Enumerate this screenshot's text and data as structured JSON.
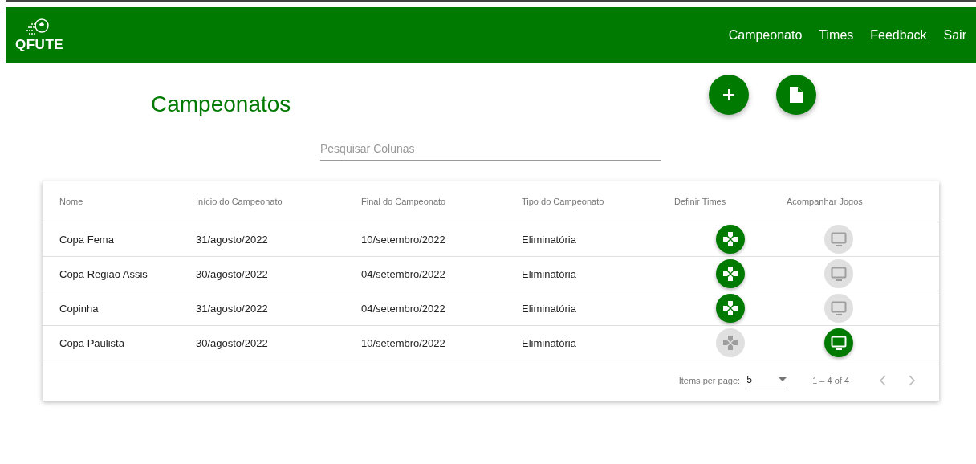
{
  "navbar": {
    "logo": "QFUTE",
    "links": [
      "Campeonato",
      "Times",
      "Feedback",
      "Sair"
    ]
  },
  "page": {
    "title": "Campeonatos"
  },
  "search": {
    "placeholder": "Pesquisar Colunas"
  },
  "table": {
    "columns": [
      "Nome",
      "Início do Campeonato",
      "Final do Campeonato",
      "Tipo do Campeonato",
      "Definir Times",
      "Acompanhar Jogos"
    ],
    "rows": [
      {
        "cells": [
          "Copa Fema",
          "31/agosto/2022",
          "10/setembro/2022",
          "Eliminatória"
        ],
        "define_disabled": false,
        "follow_disabled": true
      },
      {
        "cells": [
          "Copa Região Assis",
          "30/agosto/2022",
          "04/setembro/2022",
          "Eliminatória"
        ],
        "define_disabled": false,
        "follow_disabled": true
      },
      {
        "cells": [
          "Copinha",
          "31/agosto/2022",
          "04/setembro/2022",
          "Eliminatória"
        ],
        "define_disabled": false,
        "follow_disabled": true
      },
      {
        "cells": [
          "Copa Paulista",
          "30/agosto/2022",
          "10/setembro/2022",
          "Eliminatória"
        ],
        "define_disabled": true,
        "follow_disabled": false
      }
    ]
  },
  "paginator": {
    "label": "Items per page:",
    "page_size": "5",
    "range": "1 – 4 of 4",
    "previous_disabled": true,
    "next_disabled": true
  }
}
